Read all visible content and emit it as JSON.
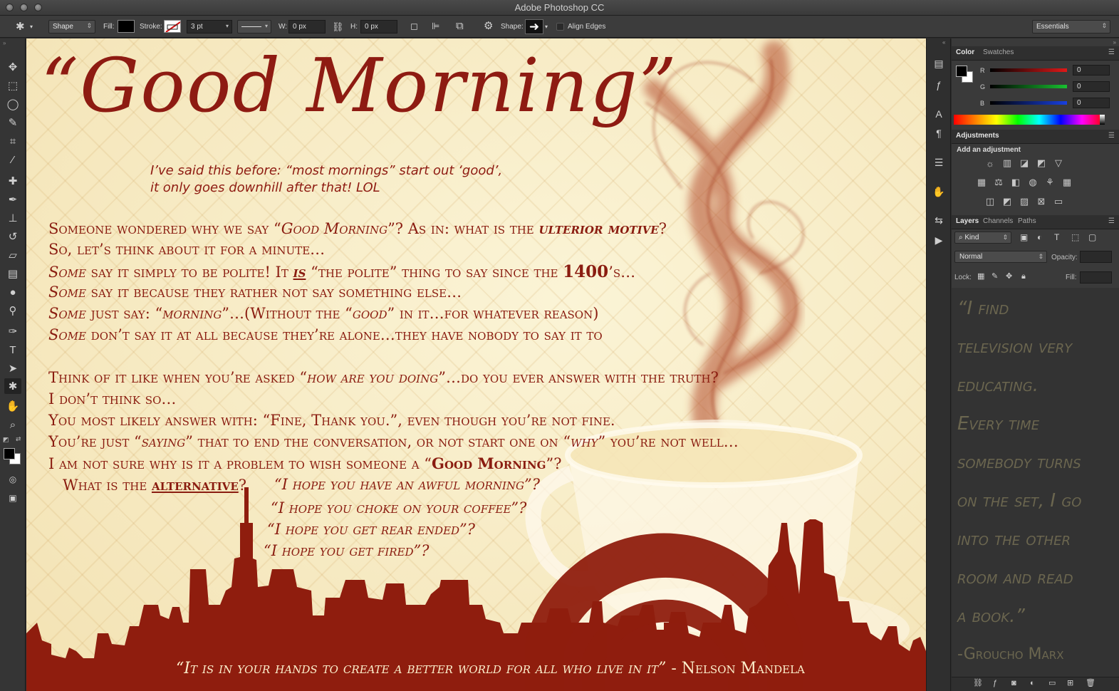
{
  "app": {
    "title": "Adobe Photoshop CC"
  },
  "options_bar": {
    "tool_mode": "Shape",
    "fill_label": "Fill:",
    "stroke_label": "Stroke:",
    "stroke_width": "3 pt",
    "w_label": "W:",
    "w_value": "0 px",
    "h_label": "H:",
    "h_value": "0 px",
    "shape_label": "Shape:",
    "align_edges_label": "Align Edges",
    "workspace": "Essentials"
  },
  "canvas": {
    "hero": {
      "open_quote": "“",
      "title": "Good Morning",
      "close_quote": "”",
      "subtitle_line1": "I’ve said this before: “most mornings” start out ‘good’,",
      "subtitle_line2": "it only goes downhill after that! LOL"
    },
    "p1": {
      "l1a": "Someone wondered why we say “",
      "l1b": "Good Morning",
      "l1c": "”? As in: what is the ",
      "l1d": "ulterior motive",
      "l1e": "?",
      "l2": "So, let’s think about it for a minute…",
      "l3a": "Some",
      "l3b": " say it simply to be polite! It ",
      "l3c": "is",
      "l3d": " “the polite” thing to say since the ",
      "l3e": "1400",
      "l3f": "’s…",
      "l4a": "Some",
      "l4b": " say it because they rather not say something else…",
      "l5a": "Some",
      "l5b": " just say: “",
      "l5c": "morning",
      "l5d": "”…(Without the “",
      "l5e": "good",
      "l5f": "” in it…for whatever reason)",
      "l6a": "Some",
      "l6b": " don’t say it at all because they’re alone…they have nobody to say it to"
    },
    "p2": {
      "l1a": "Think of it like when you’re asked “",
      "l1b": "how are you doing",
      "l1c": "”…do you ever answer with the truth?",
      "l2": "I don’t think so…",
      "l3": "You most likely answer with: “Fine, Thank you.”, even though you’re not fine.",
      "l4a": "You’re just “",
      "l4b": "saying",
      "l4c": "” that to end the conversation, or not start one on “",
      "l4d": "why",
      "l4e": "” you’re not well…",
      "l5a": "I am not sure why is it a problem to wish someone a “",
      "l5b": "Good Morning",
      "l5c": "”?",
      "l6a": "What is the ",
      "l6b": "alternative",
      "l6c": "?"
    },
    "alternatives": [
      "“I hope you have an awful morning”?",
      "“I hope you choke on your coffee”?",
      "“I hope you get rear ended”?",
      "“I hope you get fired”?"
    ],
    "footer_quote": "“It is in your hands to create  a better world for all who live in it”",
    "footer_author": " - Nelson Mandela"
  },
  "panels": {
    "color": {
      "tabs": [
        "Color",
        "Swatches"
      ],
      "channels": [
        {
          "label": "R",
          "value": "0",
          "color": "#e02020"
        },
        {
          "label": "G",
          "value": "0",
          "color": "#20b040"
        },
        {
          "label": "B",
          "value": "0",
          "color": "#2050e0"
        }
      ]
    },
    "adjustments": {
      "tab": "Adjustments",
      "heading": "Add an adjustment"
    },
    "layers": {
      "tabs": [
        "Layers",
        "Channels",
        "Paths"
      ],
      "filter_kind": "Kind",
      "blend_mode": "Normal",
      "opacity_label": "Opacity:",
      "lock_label": "Lock:",
      "fill_label": "Fill:",
      "quote_lines": [
        "“I find",
        "television very",
        "educating.",
        "Every time",
        "somebody turns",
        "on the set, I go",
        "into the other",
        "room and read",
        "a book.”",
        "-Groucho Marx"
      ]
    }
  },
  "colors": {
    "ink": "#8e1b12",
    "canvas_bg": "#f7ebc3",
    "skyline": "#8f1d0e",
    "ui_dark": "#2b2b2b"
  },
  "icons": {
    "toolbar": [
      "move-icon",
      "marquee-icon",
      "lasso-icon",
      "quick-select-icon",
      "crop-icon",
      "eyedropper-icon",
      "healing-brush-icon",
      "brush-icon",
      "clone-stamp-icon",
      "history-brush-icon",
      "eraser-icon",
      "gradient-icon",
      "blur-icon",
      "dodge-icon",
      "pen-icon",
      "type-icon",
      "path-select-icon",
      "custom-shape-icon",
      "hand-icon",
      "zoom-icon"
    ]
  }
}
